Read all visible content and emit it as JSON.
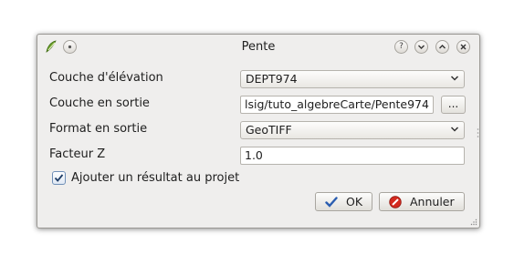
{
  "window": {
    "title": "Pente"
  },
  "form": {
    "elevation_label": "Couche d'élévation",
    "elevation_value": "DEPT974",
    "output_layer_label": "Couche en sortie",
    "output_layer_value": "lsig/tuto_algebreCarte/Pente974",
    "browse_label": "...",
    "format_label": "Format en sortie",
    "format_value": "GeoTIFF",
    "zfactor_label": "Facteur Z",
    "zfactor_value": "1.0",
    "add_result_label": "Ajouter un résultat au projet",
    "add_result_checked": true
  },
  "buttons": {
    "ok_label": "OK",
    "cancel_label": "Annuler"
  },
  "colors": {
    "ok_check": "#2a5db0",
    "cancel_red": "#d42a1f",
    "app_icon": "#6ea32b"
  },
  "icons": [
    "qgis-icon",
    "menu-icon",
    "help-icon",
    "minimize-icon",
    "maximize-icon",
    "close-icon",
    "chevron-down-icon",
    "check-icon",
    "cancel-icon"
  ]
}
